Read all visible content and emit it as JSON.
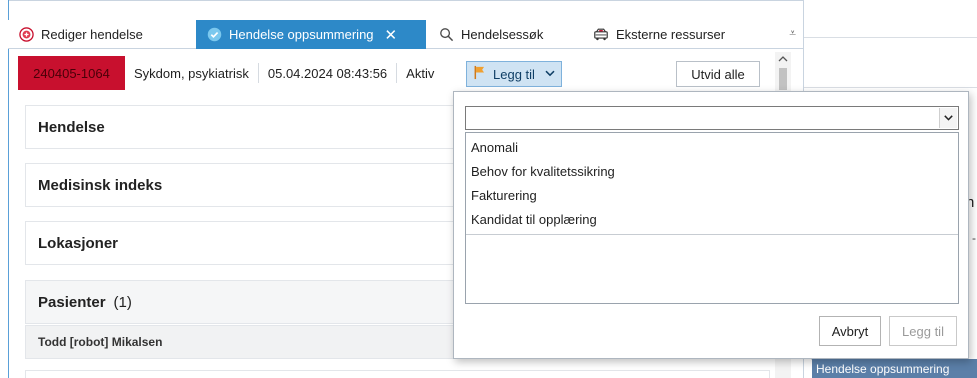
{
  "tabs": [
    {
      "label": "Rediger hendelse",
      "icon": "plus-circle-icon",
      "active": false
    },
    {
      "label": "Hendelse oppsummering",
      "icon": "check-circle-icon",
      "active": true
    },
    {
      "label": "Hendelsessøk",
      "icon": "search-icon",
      "active": false
    },
    {
      "label": "Eksterne ressurser",
      "icon": "ambulance-icon",
      "active": false
    }
  ],
  "overflow_glyph": "⩡",
  "incident": {
    "id": "240405-1064",
    "type": "Sykdom, psykiatrisk",
    "datetime": "05.04.2024 08:43:56",
    "status": "Aktiv"
  },
  "toolbar": {
    "add_label": "Legg til",
    "expand_all_label": "Utvid alle"
  },
  "sections": {
    "hendelse": "Hendelse",
    "medisinsk": "Medisinsk indeks",
    "lokasjoner": "Lokasjoner",
    "pasienter": "Pasienter",
    "pasienter_count": "(1)"
  },
  "patient": {
    "name": "Todd [robot] Mikalsen"
  },
  "popup": {
    "combo_value": "",
    "options": [
      "Anomali",
      "Behov for kvalitetssikring",
      "Fakturering",
      "Kandidat til opplæring"
    ],
    "cancel_label": "Avbryt",
    "add_label": "Legg til"
  },
  "right_panel": {
    "clip_char": "n",
    "clip_dash": "-",
    "bottom_tab": "Hendelse oppsummering"
  },
  "colors": {
    "accent": "#2d89c8",
    "case_id_bg": "#c8102e",
    "button_active_bg": "#cfe3f3"
  }
}
